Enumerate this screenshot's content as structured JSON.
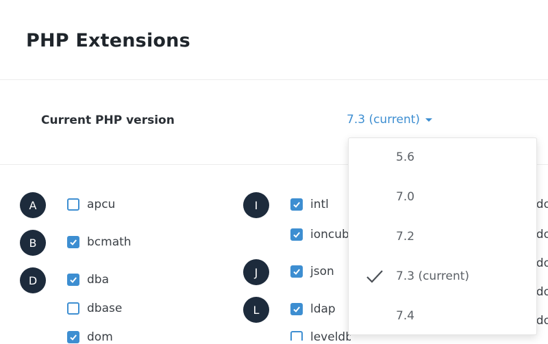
{
  "page": {
    "title": "PHP Extensions"
  },
  "version": {
    "label": "Current PHP version",
    "selected": "7.3 (current)",
    "options": [
      {
        "label": "5.6",
        "selected": false
      },
      {
        "label": "7.0",
        "selected": false
      },
      {
        "label": "7.2",
        "selected": false
      },
      {
        "label": "7.3 (current)",
        "selected": true
      },
      {
        "label": "7.4",
        "selected": false
      }
    ]
  },
  "letters": [
    "A",
    "B",
    "D",
    "I",
    "J",
    "L"
  ],
  "extensions": {
    "col1": [
      {
        "name": "apcu",
        "checked": false
      },
      {
        "name": "bcmath",
        "checked": true
      },
      {
        "name": "dba",
        "checked": true
      },
      {
        "name": "dbase",
        "checked": false
      },
      {
        "name": "dom",
        "checked": true
      }
    ],
    "col2": [
      {
        "name": "intl",
        "checked": true
      },
      {
        "name": "ioncube",
        "checked": true
      },
      {
        "name": "json",
        "checked": true
      },
      {
        "name": "ldap",
        "checked": true
      },
      {
        "name": "leveldb",
        "checked": false
      }
    ],
    "col3": [
      {
        "name": "pdo"
      },
      {
        "name": "pdo"
      },
      {
        "name": "pdo"
      },
      {
        "name": "pdo"
      },
      {
        "name": "pdo"
      }
    ]
  },
  "colors": {
    "accent": "#3d8ed1",
    "letter_bg": "#1d2b3c",
    "title": "#1f252b"
  },
  "icons": {
    "dropdown": "caret-down-icon",
    "selected_option": "checkmark-icon",
    "checkbox_checked": "checkbox-checked-icon"
  }
}
